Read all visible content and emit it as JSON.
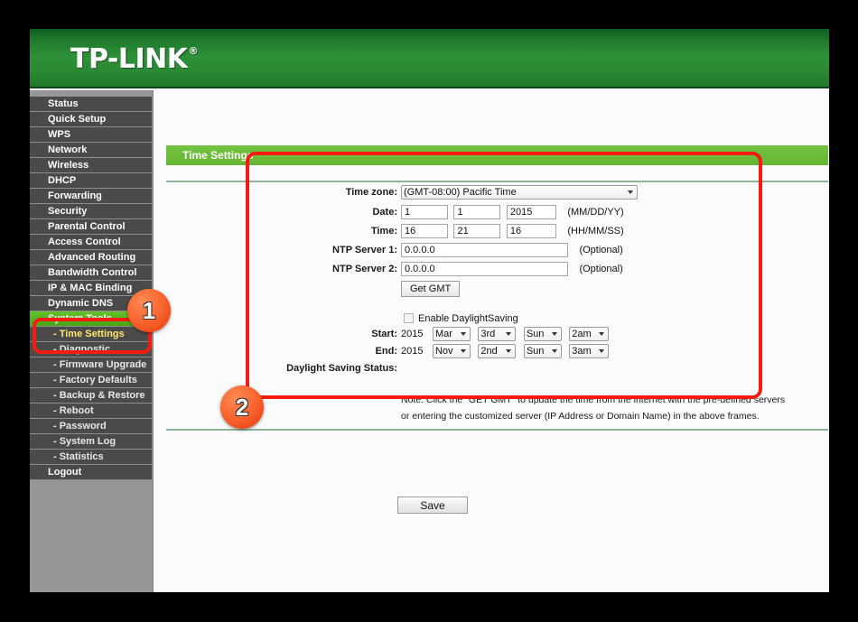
{
  "brand": {
    "logo_text": "TP-LINK",
    "registered_mark": "®"
  },
  "sidebar": {
    "items": [
      {
        "label": "Status",
        "type": "main",
        "state": "normal"
      },
      {
        "label": "Quick Setup",
        "type": "main",
        "state": "normal"
      },
      {
        "label": "WPS",
        "type": "main",
        "state": "normal"
      },
      {
        "label": "Network",
        "type": "main",
        "state": "normal"
      },
      {
        "label": "Wireless",
        "type": "main",
        "state": "normal"
      },
      {
        "label": "DHCP",
        "type": "main",
        "state": "normal"
      },
      {
        "label": "Forwarding",
        "type": "main",
        "state": "normal"
      },
      {
        "label": "Security",
        "type": "main",
        "state": "normal"
      },
      {
        "label": "Parental Control",
        "type": "main",
        "state": "normal"
      },
      {
        "label": "Access Control",
        "type": "main",
        "state": "normal"
      },
      {
        "label": "Advanced Routing",
        "type": "main",
        "state": "normal"
      },
      {
        "label": "Bandwidth Control",
        "type": "main",
        "state": "normal"
      },
      {
        "label": "IP & MAC Binding",
        "type": "main",
        "state": "normal"
      },
      {
        "label": "Dynamic DNS",
        "type": "main",
        "state": "normal"
      },
      {
        "label": "System Tools",
        "type": "main",
        "state": "active"
      },
      {
        "label": "- Time Settings",
        "type": "sub",
        "state": "active-sub"
      },
      {
        "label": "- Diagnostic",
        "type": "sub",
        "state": "normal"
      },
      {
        "label": "- Firmware Upgrade",
        "type": "sub",
        "state": "normal"
      },
      {
        "label": "- Factory Defaults",
        "type": "sub",
        "state": "normal"
      },
      {
        "label": "- Backup & Restore",
        "type": "sub",
        "state": "normal"
      },
      {
        "label": "- Reboot",
        "type": "sub",
        "state": "normal"
      },
      {
        "label": "- Password",
        "type": "sub",
        "state": "normal"
      },
      {
        "label": "- System Log",
        "type": "sub",
        "state": "normal"
      },
      {
        "label": "- Statistics",
        "type": "sub",
        "state": "normal"
      },
      {
        "label": "Logout",
        "type": "main",
        "state": "normal"
      }
    ]
  },
  "page": {
    "title": "Time Settings"
  },
  "form": {
    "timezone": {
      "label": "Time zone:",
      "value": "(GMT-08:00) Pacific Time"
    },
    "date": {
      "label": "Date:",
      "month": "1",
      "day": "1",
      "year": "2015",
      "hint": "(MM/DD/YY)"
    },
    "time": {
      "label": "Time:",
      "hour": "16",
      "minute": "21",
      "second": "16",
      "hint": "(HH/MM/SS)"
    },
    "ntp1": {
      "label": "NTP Server 1:",
      "value": "0.0.0.0",
      "hint": "(Optional)"
    },
    "ntp2": {
      "label": "NTP Server 2:",
      "value": "0.0.0.0",
      "hint": "(Optional)"
    },
    "get_gmt_button": "Get GMT",
    "daylight": {
      "enable_label": "Enable DaylightSaving",
      "enabled": false,
      "start": {
        "label": "Start:",
        "year": "2015",
        "month": "Mar",
        "week": "3rd",
        "day": "Sun",
        "hour": "2am"
      },
      "end": {
        "label": "End:",
        "year": "2015",
        "month": "Nov",
        "week": "2nd",
        "day": "Sun",
        "hour": "3am"
      },
      "status_label": "Daylight Saving Status:",
      "status_value": ""
    },
    "note_line1": "Note: Click the \"GET GMT\" to update the time from the internet with the pre-defined servers",
    "note_line2": "or entering the customized server (IP Address or Domain Name) in the above frames.",
    "save_button": "Save"
  },
  "annotations": {
    "badge_1": "1",
    "badge_2": "2",
    "highlight_color": "#f41b12",
    "badge_color": "#fb6a34"
  },
  "colors": {
    "header_green": "#2e9038",
    "title_green": "#6cbe3a",
    "active_menu_green": "#4caf16",
    "sidebar_gray": "#969696",
    "menu_dark": "#4a4a4a"
  }
}
